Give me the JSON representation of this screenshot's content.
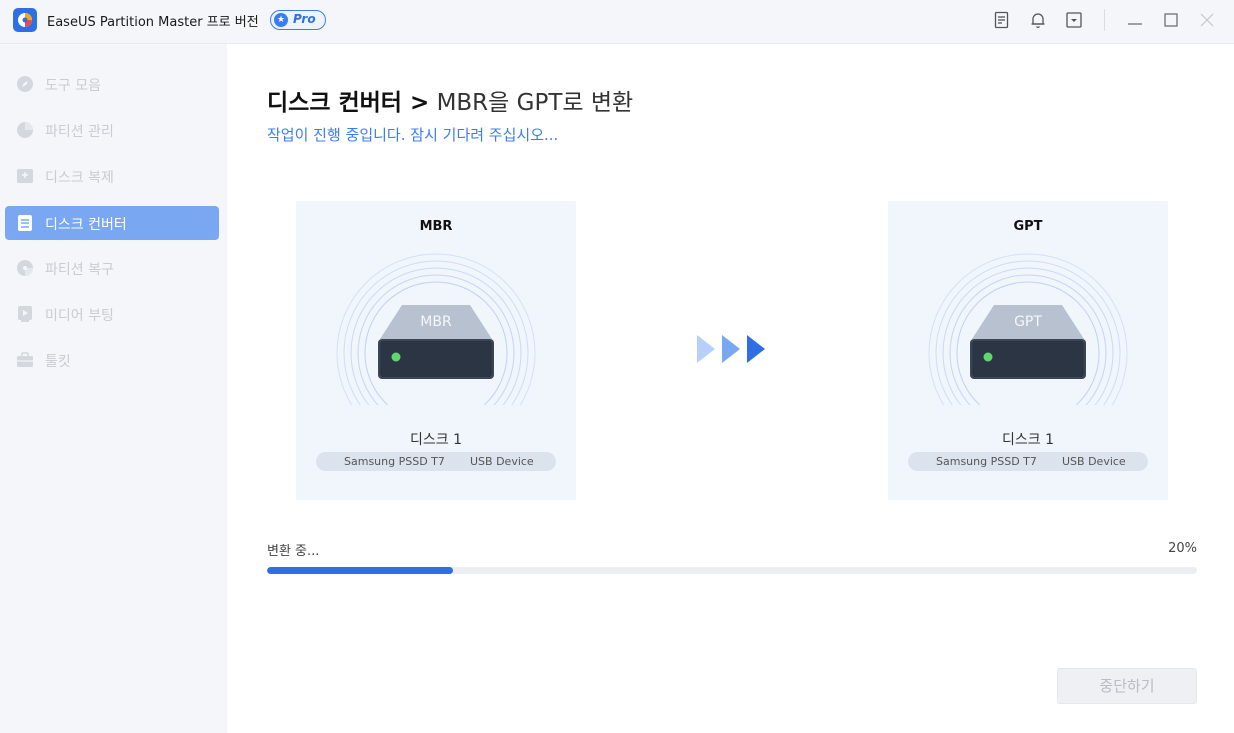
{
  "app": {
    "title": "EaseUS Partition Master 프로 버전",
    "badge": "Pro",
    "accent_color": "#2f6fe4"
  },
  "titlebar": {
    "icons": [
      "feedback-icon",
      "bell-icon",
      "dropdown-menu-icon",
      "minimize-icon",
      "maximize-icon",
      "close-icon"
    ]
  },
  "sidebar": {
    "items": [
      {
        "label": "도구 모음",
        "icon": "compass-icon",
        "active": false
      },
      {
        "label": "파티션 관리",
        "icon": "pie-chart-icon",
        "active": false
      },
      {
        "label": "디스크 복제",
        "icon": "disk-add-icon",
        "active": false
      },
      {
        "label": "디스크 컨버터",
        "icon": "disk-convert-icon",
        "active": true
      },
      {
        "label": "파티션 복구",
        "icon": "partition-recovery-icon",
        "active": false
      },
      {
        "label": "미디어 부팅",
        "icon": "media-boot-icon",
        "active": false
      },
      {
        "label": "툴킷",
        "icon": "toolbox-icon",
        "active": false
      }
    ]
  },
  "main": {
    "title_bold": "디스크 컨버터 >",
    "title_light": "MBR을 GPT로 변환",
    "subtitle": "작업이 진행 중입니다. 잠시 기다려 주십시오...",
    "source": {
      "heading": "MBR",
      "disk_label": "MBR",
      "disk_name": "디스크 1",
      "model": "Samsung  PSSD T7",
      "interface": "USB Device"
    },
    "target": {
      "heading": "GPT",
      "disk_label": "GPT",
      "disk_name": "디스크 1",
      "model": "Samsung  PSSD T7",
      "interface": "USB Device"
    },
    "progress": {
      "label": "변환 중...",
      "percent_text": "20%",
      "fraction": 0.2
    },
    "stop_button": "중단하기"
  }
}
